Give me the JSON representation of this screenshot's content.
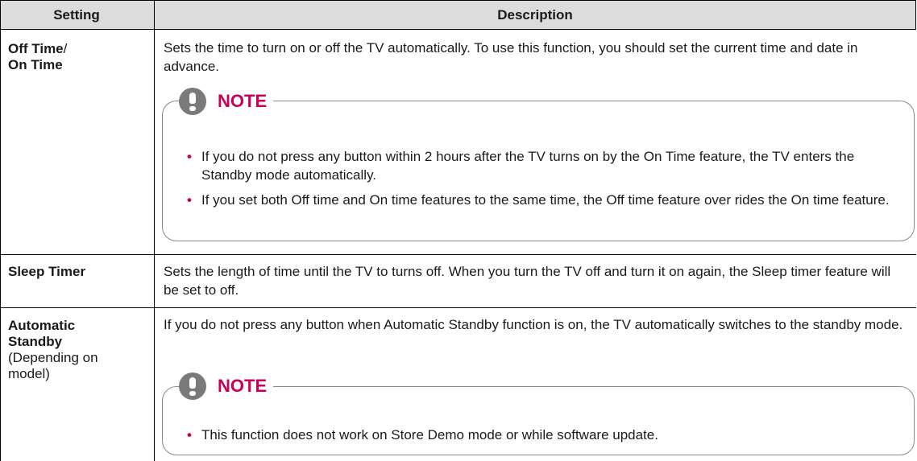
{
  "header": {
    "setting": "Setting",
    "description": "Description"
  },
  "rows": [
    {
      "setting_bold_1": "Off Time",
      "setting_plain_1": "/",
      "setting_bold_2": "On Time",
      "description": "Sets the time to turn on or off the TV automatically. To use this function, you should set the current time and date in advance.",
      "note": {
        "title": "NOTE",
        "items": [
          "If you do not press any button within 2 hours after the TV turns on by the On Time feature, the TV enters the Standby mode automatically.",
          "If you set both Off time and On time features to the same time, the Off time feature over rides the On time feature."
        ]
      }
    },
    {
      "setting_bold_1": "Sleep Timer",
      "description": "Sets the length of time until the TV to turns off. When you turn the TV off and turn it on again, the Sleep timer feature will be set to off."
    },
    {
      "setting_bold_1": "Automatic",
      "setting_bold_2": "Standby",
      "setting_plain_1": "(Depending on",
      "setting_plain_2": "model)",
      "description": "If you do not press any button when Automatic Standby function is on, the TV automatically switches to the standby mode.",
      "note": {
        "title": "NOTE",
        "items": [
          "This function does not work on Store Demo mode or while software update."
        ]
      }
    }
  ],
  "bullet_glyph": "•",
  "colors": {
    "note_accent": "#c8005a",
    "header_bg": "#dcdcdc",
    "icon_gray": "#7a7a7a"
  }
}
